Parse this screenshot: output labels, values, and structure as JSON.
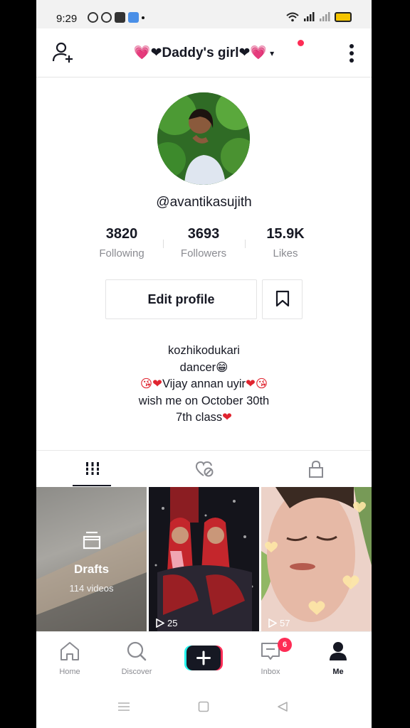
{
  "status_bar": {
    "time": "9:29"
  },
  "header": {
    "title_text": "Daddy's girl",
    "title_caret": "▾"
  },
  "profile": {
    "username": "@avantikasujith",
    "stats": [
      {
        "value": "3820",
        "label": "Following"
      },
      {
        "value": "3693",
        "label": "Followers"
      },
      {
        "value": "15.9K",
        "label": "Likes"
      }
    ],
    "edit_label": "Edit profile",
    "bio": [
      {
        "pre": "",
        "text": "kozhikodukari",
        "post": ""
      },
      {
        "pre": "",
        "text": "dancer",
        "post": "😁"
      },
      {
        "pre": "😘❤",
        "text": "Vijay annan uyir",
        "post": "❤😘"
      },
      {
        "pre": "",
        "text": "wish me on October 30th",
        "post": ""
      },
      {
        "pre": "",
        "text": "7th class",
        "post": "❤"
      }
    ]
  },
  "tabs": [
    {
      "icon": "grid-icon",
      "active": true
    },
    {
      "icon": "liked-hidden-icon",
      "active": false
    },
    {
      "icon": "lock-icon",
      "active": false
    }
  ],
  "grid": {
    "drafts_label": "Drafts",
    "drafts_count": "114 videos",
    "videos": [
      {
        "views": "25"
      },
      {
        "views": "57"
      }
    ]
  },
  "bottom_nav": {
    "items": [
      {
        "label": "Home",
        "icon": "home-icon"
      },
      {
        "label": "Discover",
        "icon": "search-icon"
      },
      {
        "label": "Inbox",
        "icon": "inbox-icon"
      },
      {
        "label": "Me",
        "icon": "profile-icon"
      }
    ],
    "inbox_badge": "6",
    "create_icon": "plus-icon"
  },
  "colors": {
    "accent": "#fe2c55",
    "cyan": "#25f4ee",
    "text": "#161823",
    "muted": "#8a8b91"
  }
}
